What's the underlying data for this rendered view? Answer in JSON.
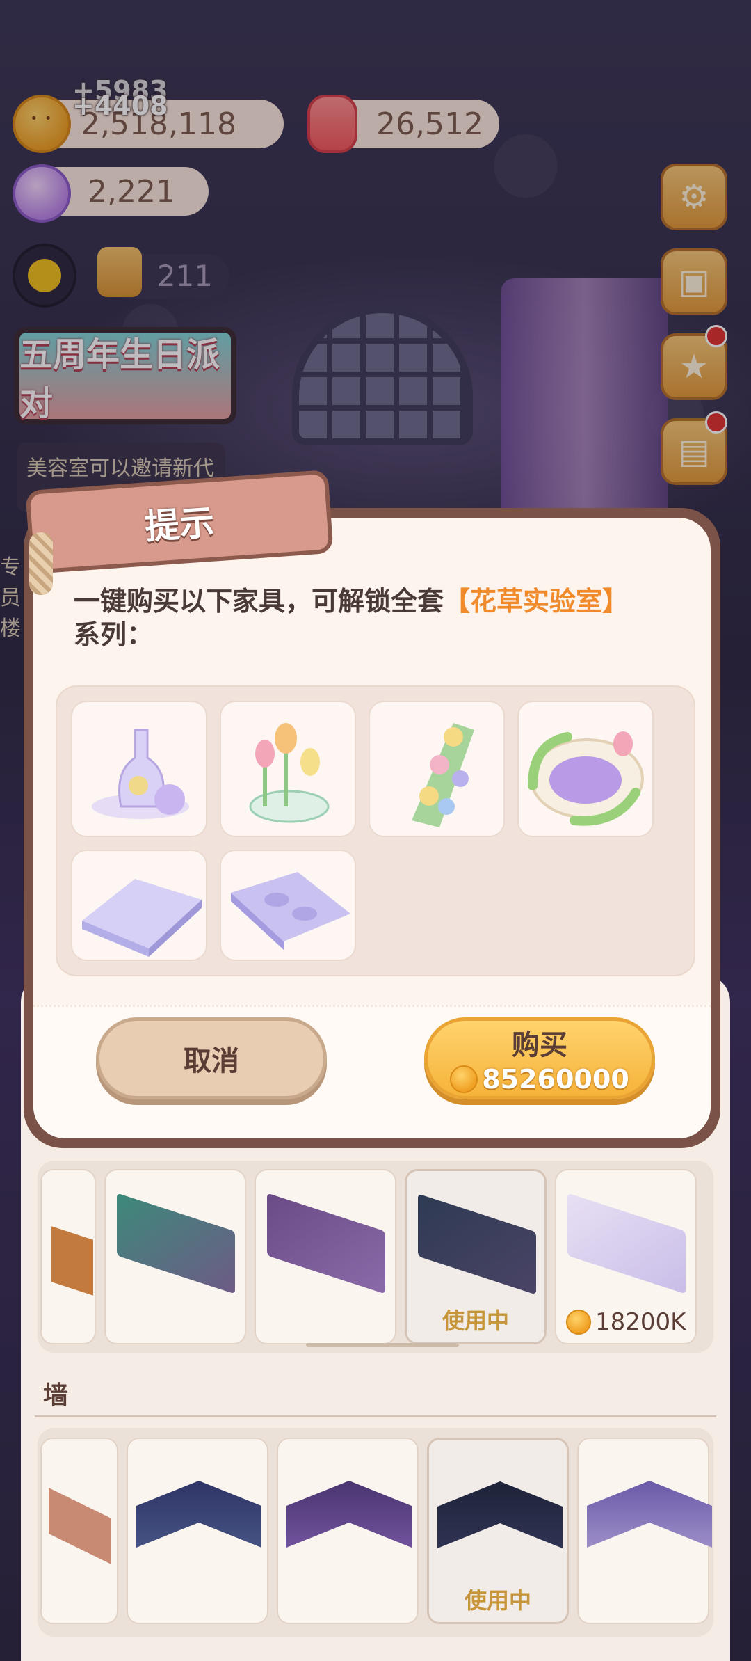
{
  "hud": {
    "coins": "2,518,118",
    "coin_gain_a": "+5983",
    "coin_gain_b": "+4408",
    "candles": "26,512",
    "candy": "2,221",
    "tickets": "211"
  },
  "event_banner": "五周年生日派对",
  "notice": "美容室可以邀请新代",
  "left_edge_text": "专员楼",
  "side_icons": [
    "gear-icon",
    "clipboard-icon",
    "star-icon",
    "bag-icon"
  ],
  "dialog": {
    "title": "提示",
    "message_prefix": "一键购买以下家具，可解锁全套",
    "series_name": "【花草实验室】",
    "message_suffix": "系列：",
    "items": [
      "vase-furniture",
      "tulip-planter-furniture",
      "flower-bush-furniture",
      "round-bed-furniture",
      "purple-floor-tile-1",
      "purple-floor-tile-2"
    ],
    "cancel_label": "取消",
    "buy_label": "购买",
    "buy_price": "85260000"
  },
  "floor_row": {
    "in_use_label": "使用中",
    "price": "18200K"
  },
  "wall_section": {
    "title": "墙",
    "in_use_label": "使用中"
  },
  "colors": {
    "accent_orange": "#f08a2a",
    "dialog_border": "#7a5247",
    "buy_button": "#f6b33a",
    "cancel_button": "#e8cdb3"
  }
}
